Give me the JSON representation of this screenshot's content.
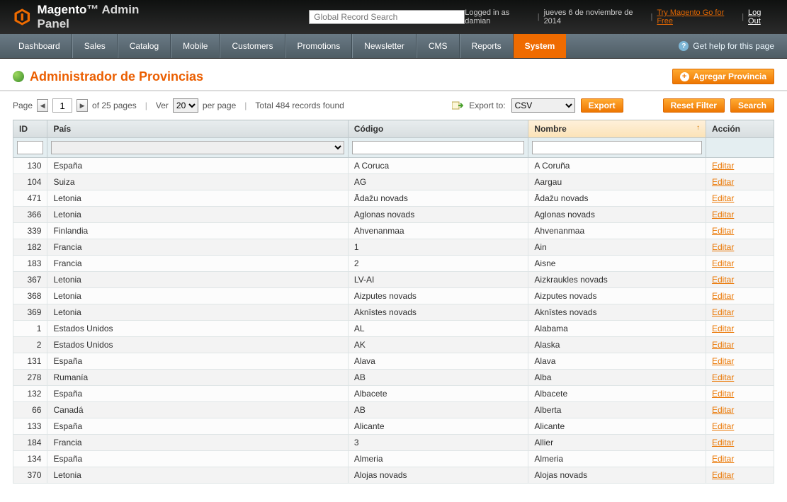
{
  "header": {
    "logo_text": "Magento",
    "logo_sub": "Admin Panel",
    "search_placeholder": "Global Record Search",
    "logged_in": "Logged in as damian",
    "date": "jueves 6 de noviembre de 2014",
    "try_link": "Try Magento Go for Free",
    "logout": "Log Out"
  },
  "nav": {
    "items": [
      "Dashboard",
      "Sales",
      "Catalog",
      "Mobile",
      "Customers",
      "Promotions",
      "Newsletter",
      "CMS",
      "Reports",
      "System"
    ],
    "active_index": 9,
    "help": "Get help for this page"
  },
  "title": {
    "text": "Administrador de Provincias",
    "add_button": "Agregar Provincia"
  },
  "grid_ctrl": {
    "page_label": "Page",
    "page_value": "1",
    "of_text": "of 25 pages",
    "ver_label": "Ver",
    "per_page_value": "20",
    "per_page_label": "per page",
    "total_text": "Total 484 records found",
    "export_label": "Export to:",
    "export_value": "CSV",
    "export_btn": "Export",
    "reset_btn": "Reset Filter",
    "search_btn": "Search"
  },
  "columns": {
    "id": "ID",
    "pais": "País",
    "codigo": "Código",
    "nombre": "Nombre",
    "accion": "Acción"
  },
  "edit_label": "Editar",
  "rows": [
    {
      "id": "130",
      "pais": "España",
      "cod": "A Coruca",
      "nom": "A Coruña"
    },
    {
      "id": "104",
      "pais": "Suiza",
      "cod": "AG",
      "nom": "Aargau"
    },
    {
      "id": "471",
      "pais": "Letonia",
      "cod": "Ādažu novads",
      "nom": "Ādažu novads"
    },
    {
      "id": "366",
      "pais": "Letonia",
      "cod": "Aglonas novads",
      "nom": "Aglonas novads"
    },
    {
      "id": "339",
      "pais": "Finlandia",
      "cod": "Ahvenanmaa",
      "nom": "Ahvenanmaa"
    },
    {
      "id": "182",
      "pais": "Francia",
      "cod": "1",
      "nom": "Ain"
    },
    {
      "id": "183",
      "pais": "Francia",
      "cod": "2",
      "nom": "Aisne"
    },
    {
      "id": "367",
      "pais": "Letonia",
      "cod": "LV-AI",
      "nom": "Aizkraukles novads"
    },
    {
      "id": "368",
      "pais": "Letonia",
      "cod": "Aizputes novads",
      "nom": "Aizputes novads"
    },
    {
      "id": "369",
      "pais": "Letonia",
      "cod": "Aknīstes novads",
      "nom": "Aknīstes novads"
    },
    {
      "id": "1",
      "pais": "Estados Unidos",
      "cod": "AL",
      "nom": "Alabama"
    },
    {
      "id": "2",
      "pais": "Estados Unidos",
      "cod": "AK",
      "nom": "Alaska"
    },
    {
      "id": "131",
      "pais": "España",
      "cod": "Alava",
      "nom": "Alava"
    },
    {
      "id": "278",
      "pais": "Rumanía",
      "cod": "AB",
      "nom": "Alba"
    },
    {
      "id": "132",
      "pais": "España",
      "cod": "Albacete",
      "nom": "Albacete"
    },
    {
      "id": "66",
      "pais": "Canadá",
      "cod": "AB",
      "nom": "Alberta"
    },
    {
      "id": "133",
      "pais": "España",
      "cod": "Alicante",
      "nom": "Alicante"
    },
    {
      "id": "184",
      "pais": "Francia",
      "cod": "3",
      "nom": "Allier"
    },
    {
      "id": "134",
      "pais": "España",
      "cod": "Almeria",
      "nom": "Almeria"
    },
    {
      "id": "370",
      "pais": "Letonia",
      "cod": "Alojas novads",
      "nom": "Alojas novads"
    }
  ]
}
